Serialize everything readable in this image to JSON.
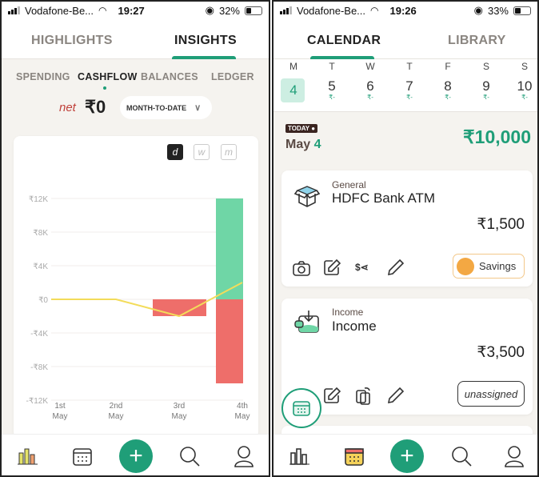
{
  "left": {
    "status": {
      "carrier": "Vodafone-Be...",
      "time": "19:27",
      "battery": "32%",
      "battery_level": 0.32
    },
    "tabs": [
      {
        "label": "HIGHLIGHTS",
        "active": false
      },
      {
        "label": "INSIGHTS",
        "active": true
      }
    ],
    "subtabs": [
      {
        "label": "SPENDING"
      },
      {
        "label": "CASHFLOW",
        "active": true
      },
      {
        "label": "BALANCES"
      },
      {
        "label": "LEDGER"
      }
    ],
    "net_label": "net",
    "net_value": "₹0",
    "period": "MONTH-TO-DATE",
    "granularity": [
      {
        "label": "d",
        "active": true
      },
      {
        "label": "w"
      },
      {
        "label": "m"
      }
    ],
    "nav": [
      "chart-icon",
      "calendar-icon",
      "add-icon",
      "search-icon",
      "profile-icon"
    ],
    "active_nav": "chart-icon"
  },
  "chart_data": {
    "type": "bar",
    "categories": [
      "1st May",
      "2nd May",
      "3rd May",
      "4th May"
    ],
    "series": [
      {
        "values": [
          0,
          0,
          0,
          12000
        ],
        "color": "#6fd6a6"
      },
      {
        "values": [
          0,
          0,
          -2000,
          -10000
        ],
        "color": "#ee6e6a"
      },
      {
        "type": "line",
        "values": [
          0,
          0,
          -2000,
          2000
        ],
        "color": "#f3dc5a"
      }
    ],
    "yticks": [
      "₹12K",
      "₹8K",
      "₹4K",
      "₹0",
      "-₹4K",
      "-₹8K",
      "-₹12K"
    ],
    "ylim": [
      -12000,
      12000
    ],
    "grid": true
  },
  "right": {
    "status": {
      "carrier": "Vodafone-Be...",
      "time": "19:26",
      "battery": "33%",
      "battery_level": 0.33
    },
    "tabs": [
      {
        "label": "CALENDAR",
        "active": true
      },
      {
        "label": "LIBRARY",
        "active": false
      }
    ],
    "week": [
      {
        "d": "M",
        "n": "4",
        "selected": true,
        "amt": ""
      },
      {
        "d": "T",
        "n": "5",
        "amt": "₹-"
      },
      {
        "d": "W",
        "n": "6",
        "amt": "₹-"
      },
      {
        "d": "T",
        "n": "7",
        "amt": "₹-"
      },
      {
        "d": "F",
        "n": "8",
        "amt": "₹-"
      },
      {
        "d": "S",
        "n": "9",
        "amt": "₹-"
      },
      {
        "d": "S",
        "n": "10",
        "amt": "₹-"
      }
    ],
    "today_badge": "TODAY",
    "date_month": "May",
    "date_day": "4",
    "total": "₹10,000",
    "transactions": [
      {
        "category": "General",
        "title": "HDFC Bank ATM",
        "amount": "₹1,500",
        "tag": "Savings",
        "icon": "box-icon"
      },
      {
        "category": "Income",
        "title": "Income",
        "amount": "₹3,500",
        "tag": "unassigned",
        "icon": "income-icon"
      }
    ],
    "active_nav": "calendar-icon"
  }
}
